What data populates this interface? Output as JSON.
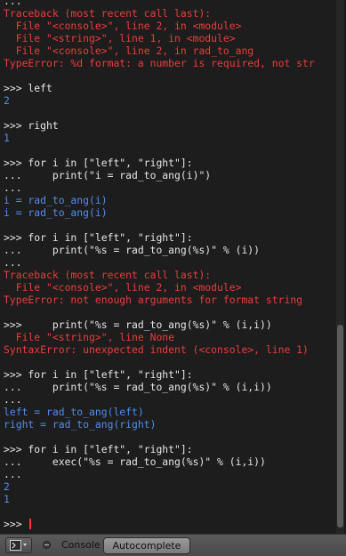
{
  "console": {
    "lines": [
      {
        "kind": "input",
        "text": "..."
      },
      {
        "kind": "error",
        "text": "Traceback (most recent call last):"
      },
      {
        "kind": "error",
        "text": "  File \"<console>\", line 2, in <module>"
      },
      {
        "kind": "error",
        "text": "  File \"<string>\", line 1, in <module>"
      },
      {
        "kind": "error",
        "text": "  File \"<console>\", line 2, in rad_to_ang"
      },
      {
        "kind": "error",
        "text": "TypeError: %d format: a number is required, not str"
      },
      {
        "kind": "blank",
        "text": ""
      },
      {
        "kind": "input",
        "text": ">>> left"
      },
      {
        "kind": "output",
        "text": "2"
      },
      {
        "kind": "blank",
        "text": ""
      },
      {
        "kind": "input",
        "text": ">>> right"
      },
      {
        "kind": "output",
        "text": "1"
      },
      {
        "kind": "blank",
        "text": ""
      },
      {
        "kind": "input",
        "text": ">>> for i in [\"left\", \"right\"]:"
      },
      {
        "kind": "input",
        "text": "...     print(\"i = rad_to_ang(i)\")"
      },
      {
        "kind": "input",
        "text": "..."
      },
      {
        "kind": "output",
        "text": "i = rad_to_ang(i)"
      },
      {
        "kind": "output",
        "text": "i = rad_to_ang(i)"
      },
      {
        "kind": "blank",
        "text": ""
      },
      {
        "kind": "input",
        "text": ">>> for i in [\"left\", \"right\"]:"
      },
      {
        "kind": "input",
        "text": "...     print(\"%s = rad_to_ang(%s)\" % (i))"
      },
      {
        "kind": "input",
        "text": "..."
      },
      {
        "kind": "error",
        "text": "Traceback (most recent call last):"
      },
      {
        "kind": "error",
        "text": "  File \"<console>\", line 2, in <module>"
      },
      {
        "kind": "error",
        "text": "TypeError: not enough arguments for format string"
      },
      {
        "kind": "blank",
        "text": ""
      },
      {
        "kind": "input",
        "text": ">>>     print(\"%s = rad_to_ang(%s)\" % (i,i))"
      },
      {
        "kind": "error",
        "text": "  File \"<string>\", line None"
      },
      {
        "kind": "error",
        "text": "SyntaxError: unexpected indent (<console>, line 1)"
      },
      {
        "kind": "blank",
        "text": ""
      },
      {
        "kind": "input",
        "text": ">>> for i in [\"left\", \"right\"]:"
      },
      {
        "kind": "input",
        "text": "...     print(\"%s = rad_to_ang(%s)\" % (i,i))"
      },
      {
        "kind": "input",
        "text": "..."
      },
      {
        "kind": "output",
        "text": "left = rad_to_ang(left)"
      },
      {
        "kind": "output",
        "text": "right = rad_to_ang(right)"
      },
      {
        "kind": "blank",
        "text": ""
      },
      {
        "kind": "input",
        "text": ">>> for i in [\"left\", \"right\"]:"
      },
      {
        "kind": "input",
        "text": "...     exec(\"%s = rad_to_ang(%s)\" % (i,i))"
      },
      {
        "kind": "input",
        "text": "..."
      },
      {
        "kind": "output",
        "text": "2"
      },
      {
        "kind": "output",
        "text": "1"
      },
      {
        "kind": "blank",
        "text": ""
      }
    ],
    "prompt": ">>> ",
    "colors": {
      "background": "#1d1d1d",
      "input": "#e6e6e6",
      "output": "#4f8df0",
      "error": "#ee3b3b",
      "cursor": "#ff3030"
    }
  },
  "footer": {
    "editor_type_icon": "console-editor-icon",
    "collapse_icon": "collapse-menu-icon",
    "menu_console": "Console",
    "autocomplete_label": "Autocomplete"
  }
}
